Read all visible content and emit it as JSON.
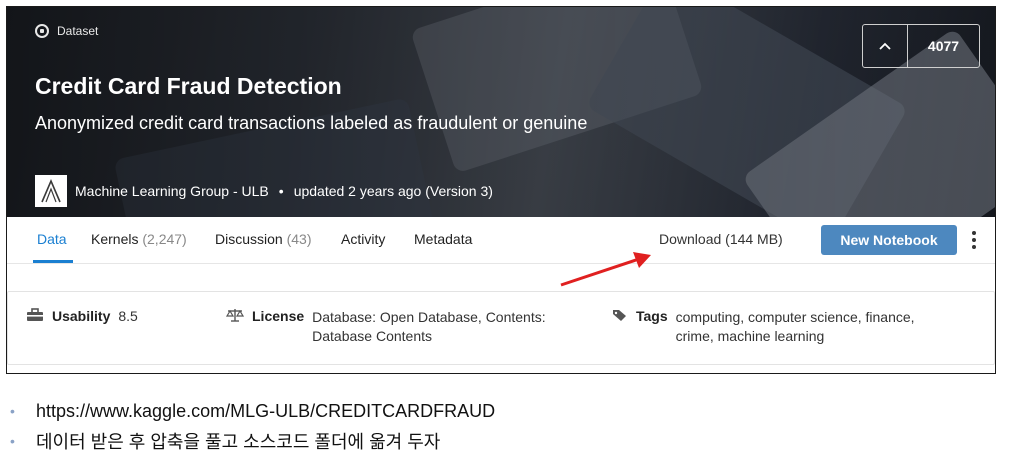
{
  "hero": {
    "dataset_label": "Dataset",
    "title": "Credit Card Fraud Detection",
    "subtitle": "Anonymized credit card transactions labeled as fraudulent or genuine",
    "owner": "Machine Learning Group - ULB",
    "updated": "updated 2 years ago (Version 3)",
    "vote_count": "4077"
  },
  "tabs": {
    "data": "Data",
    "kernels": "Kernels",
    "kernels_count": "(2,247)",
    "discussion": "Discussion",
    "discussion_count": "(43)",
    "activity": "Activity",
    "metadata": "Metadata"
  },
  "actions": {
    "download": "Download (144 MB)",
    "new_notebook": "New Notebook"
  },
  "meta": {
    "usability_label": "Usability",
    "usability_value": "8.5",
    "license_label": "License",
    "license_line1": "Database: Open Database, Contents:",
    "license_line2": "Database Contents",
    "tags_label": "Tags",
    "tags_line1": "computing, computer science, finance,",
    "tags_line2": "crime, machine learning"
  },
  "bullets": {
    "url": "https://www.kaggle.com/MLG-ULB/CREDITCARDFRAUD",
    "note": "데이터 받은 후 압축을 풀고 소스코드 폴더에 옮겨 두자"
  },
  "colors": {
    "accent": "#1a7fd1",
    "button": "#4d88bf",
    "arrow": "#e02020"
  }
}
